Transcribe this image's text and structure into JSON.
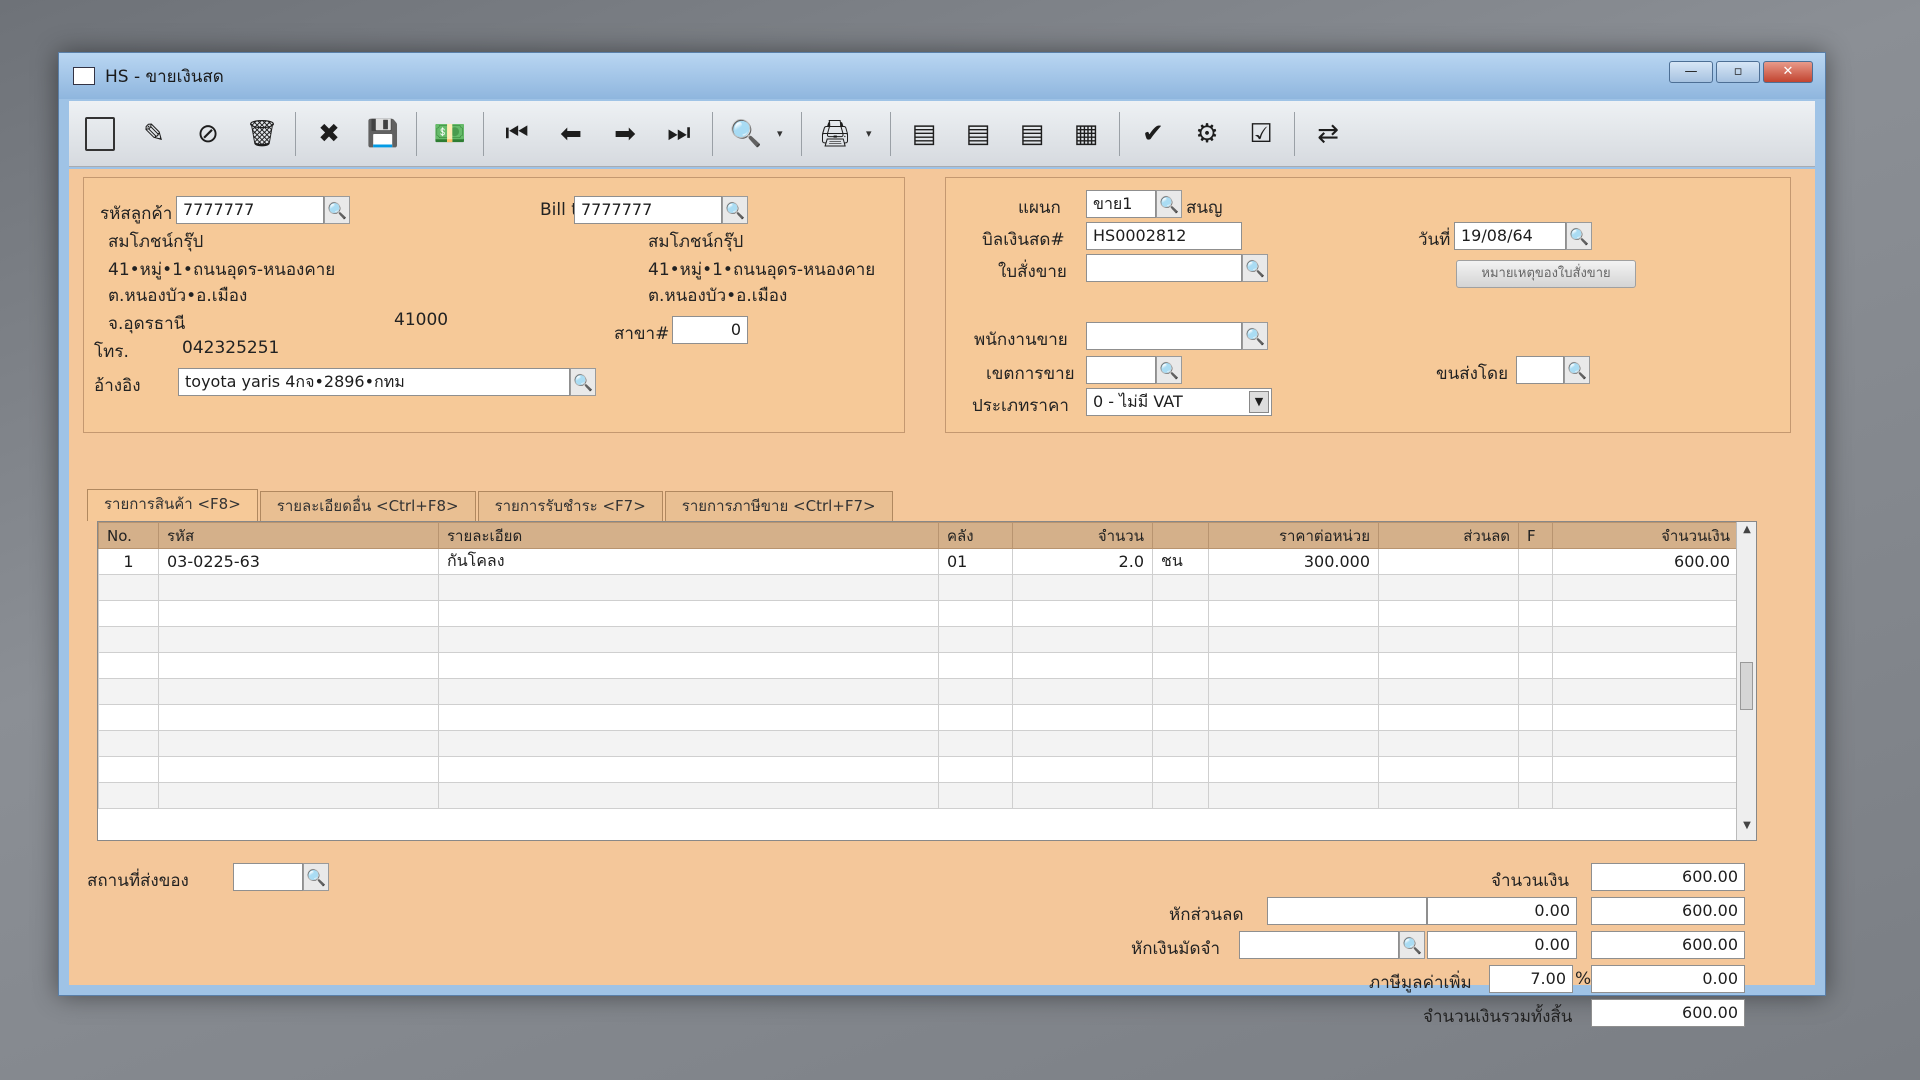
{
  "window": {
    "title": "HS - ขายเงินสด",
    "minimize": "—",
    "maximize": "▫",
    "close": "✕"
  },
  "toolbar": [
    {
      "name": "new-doc-icon",
      "glyph": ""
    },
    {
      "name": "edit-icon",
      "glyph": "✎"
    },
    {
      "name": "void-icon",
      "glyph": "⊘"
    },
    {
      "name": "trash-icon",
      "glyph": "🗑"
    },
    {
      "name": "cancel-icon",
      "glyph": "✖"
    },
    {
      "name": "save-icon",
      "glyph": "💾"
    },
    {
      "name": "money-icon",
      "glyph": "💵"
    },
    {
      "name": "first-record-icon",
      "glyph": "⏮"
    },
    {
      "name": "prev-record-icon",
      "glyph": "⬅"
    },
    {
      "name": "next-record-icon",
      "glyph": "➡"
    },
    {
      "name": "last-record-icon",
      "glyph": "⏭"
    },
    {
      "name": "search-doc-icon",
      "glyph": "🔍"
    },
    {
      "name": "print-icon",
      "glyph": "🖨"
    },
    {
      "name": "report1-icon",
      "glyph": "▤"
    },
    {
      "name": "report2-icon",
      "glyph": "▤"
    },
    {
      "name": "report3-icon",
      "glyph": "▤"
    },
    {
      "name": "report4-icon",
      "glyph": "▦"
    },
    {
      "name": "approve-icon",
      "glyph": "✔"
    },
    {
      "name": "lock-ok-icon",
      "glyph": "⚙"
    },
    {
      "name": "ok-icon",
      "glyph": "☑"
    },
    {
      "name": "transfer-icon",
      "glyph": "⇄"
    }
  ],
  "customer": {
    "code_label": "รหัสลูกค้า",
    "code": "7777777",
    "name": "สมโภชน์กรุ๊ป",
    "addr1": "41•หมู่•1•ถนนอุดร-หนองคาย",
    "addr2": "ต.หนองบัว•อ.เมือง",
    "addr3": "จ.อุดรธานี",
    "zip": "41000",
    "tel_label": "โทร.",
    "tel": "042325251",
    "ref_label": "อ้างอิง",
    "ref": "toyota yaris 4กจ•2896•กทม"
  },
  "billto": {
    "label": "Bill to",
    "code": "7777777",
    "name": "สมโภชน์กรุ๊ป",
    "addr1": "41•หมู่•1•ถนนอุดร-หนองคาย",
    "addr2": "ต.หนองบัว•อ.เมือง",
    "branch_label": "สาขา#",
    "branch": "0"
  },
  "doc": {
    "dept_label": "แผนก",
    "dept": "ขาย1",
    "dept_name": "สนญ",
    "bill_label": "บิลเงินสด#",
    "bill": "HS0002812",
    "order_label": "ใบสั่งขาย",
    "order": "",
    "date_label": "วันที่",
    "date": "19/08/64",
    "note_button": "หมายเหตุของใบสั่งขาย",
    "salesman_label": "พนักงานขาย",
    "salesman": "",
    "area_label": "เขตการขาย",
    "area": "",
    "ship_label": "ขนส่งโดย",
    "ship": "",
    "pricetype_label": "ประเภทราคา",
    "pricetype": "0 - ไม่มี VAT"
  },
  "tabs": [
    "รายการสินค้า <F8>",
    "รายละเอียดอื่น <Ctrl+F8>",
    "รายการรับชำระ <F7>",
    "รายการภาษีขาย <Ctrl+F7>"
  ],
  "grid": {
    "columns": [
      "No.",
      "รหัส",
      "รายละเอียด",
      "คลัง",
      "จำนวน",
      "",
      "ราคาต่อหน่วย",
      "ส่วนลด",
      "F",
      "จำนวนเงิน"
    ],
    "rows": [
      [
        "1",
        "03-0225-63",
        "กันโคลง",
        "01",
        "2.0",
        "ชน",
        "300.000",
        "",
        "",
        "600.00"
      ]
    ]
  },
  "footer": {
    "delivery_label": "สถานที่ส่งของ",
    "delivery": "",
    "amount_label": "จำนวนเงิน",
    "amount": "600.00",
    "discount_label": "หักส่วนลด",
    "discount_code": "",
    "discount_value": "0.00",
    "after_discount": "600.00",
    "deposit_label": "หักเงินมัดจำ",
    "deposit_code": "",
    "deposit_value": "0.00",
    "after_deposit": "600.00",
    "vat_label": "ภาษีมูลค่าเพิ่ม",
    "vat_rate": "7.00",
    "vat_pct": "%",
    "vat_amount": "0.00",
    "total_label": "จำนวนเงินรวมทั้งสิ้น",
    "total": "600.00"
  }
}
